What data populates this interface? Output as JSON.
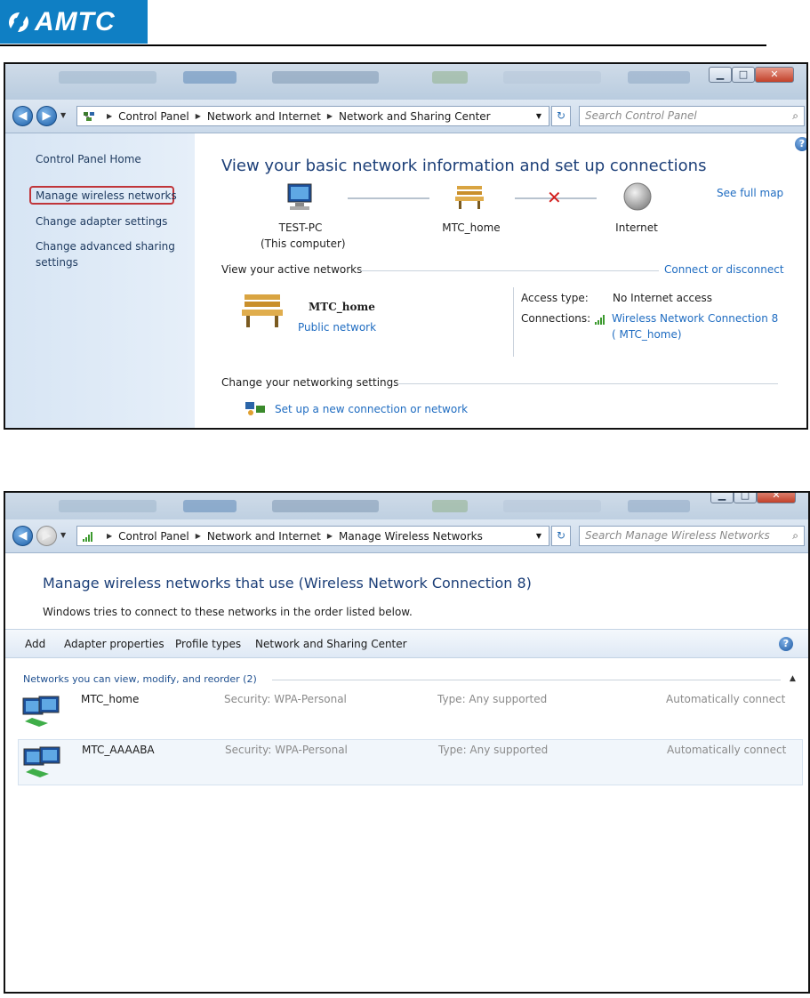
{
  "brand": {
    "logo_text": "AMTC"
  },
  "window1": {
    "breadcrumb": [
      "Control Panel",
      "Network and Internet",
      "Network and Sharing Center"
    ],
    "search_placeholder": "Search Control Panel",
    "left_links": {
      "home": "Control Panel Home",
      "manage_wireless": "Manage wireless networks",
      "adapter": "Change adapter settings",
      "advanced_line1": "Change advanced sharing",
      "advanced_line2": "settings"
    },
    "title": "View your basic network information and set up connections",
    "see_full_map": "See full map",
    "map": {
      "computer_name": "TEST-PC",
      "computer_sub": "(This computer)",
      "network_name": "MTC_home",
      "internet": "Internet"
    },
    "active_networks_label": "View your active networks",
    "connect_disconnect": "Connect or disconnect",
    "active": {
      "name": "MTC_home",
      "category": "Public network",
      "access_type_label": "Access type:",
      "access_type_value": "No Internet access",
      "connections_label": "Connections:",
      "connection_name": "Wireless Network Connection 8",
      "connection_ssid": "(  MTC_home)"
    },
    "change_settings_label": "Change your networking settings",
    "setup_link": "Set up a new connection or network"
  },
  "window2": {
    "breadcrumb": [
      "Control Panel",
      "Network and Internet",
      "Manage Wireless Networks"
    ],
    "search_placeholder": "Search Manage Wireless Networks",
    "title": "Manage wireless networks that use (Wireless Network Connection 8)",
    "subtitle": "Windows tries to connect to these networks in the order listed below.",
    "toolbar": [
      "Add",
      "Adapter properties",
      "Profile types",
      "Network and Sharing Center"
    ],
    "group_label": "Networks you can view, modify, and reorder (2)",
    "networks": [
      {
        "name": "MTC_home",
        "security": "Security:  WPA-Personal",
        "type": "Type:  Any supported",
        "mode": "Automatically connect"
      },
      {
        "name": "MTC_AAAABA",
        "security": "Security:  WPA-Personal",
        "type": "Type:  Any supported",
        "mode": "Automatically connect"
      }
    ]
  },
  "colors": {
    "link": "#1f6cc1",
    "title": "#1c3f78",
    "highlight": "#c0353a",
    "logo_bg": "#0f7fc4"
  }
}
